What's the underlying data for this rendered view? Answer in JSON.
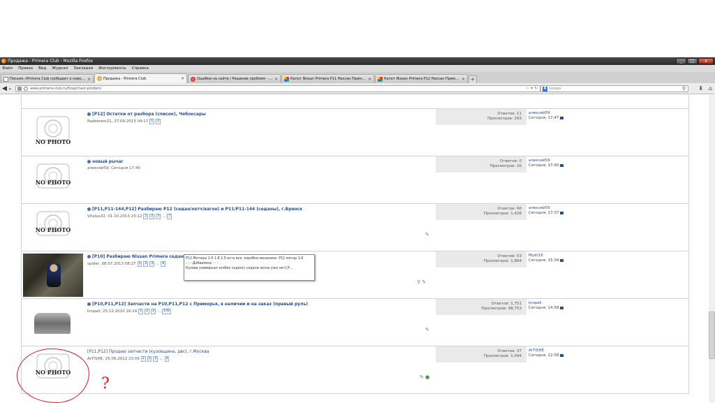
{
  "window": {
    "title": "Продажа - Primera Club - Mozilla Firefox",
    "buttons": [
      "_",
      "□",
      "x"
    ]
  },
  "menu": [
    "Файл",
    "Правка",
    "Вид",
    "Журнал",
    "Закладки",
    "Инструменты",
    "Справка"
  ],
  "tabs": [
    {
      "label": "Письмо «Primera Club сообщает о ново...",
      "icon": "page-icon"
    },
    {
      "label": "Продажа - Primera Club",
      "icon": "firefox-icon",
      "active": true
    },
    {
      "label": "Ошибки на сайте / Решение проблем - ...",
      "icon": "red-circle-icon"
    },
    {
      "label": "Капот Nissan Primera P11 Ниссан Прим...",
      "icon": "multicolor-icon"
    },
    {
      "label": "Капот Nissan Primera P12 Ниссан Прим...",
      "icon": "multicolor-icon"
    }
  ],
  "tab_close": "×",
  "new_tab": "+",
  "nav": {
    "url": "www.primera-club.ru/f/zapchast-prodam/",
    "search_placeholder": "Google",
    "search_engine_letter": "8"
  },
  "topics": [
    {
      "title": "[P12] Остатки от разбора (список), Чебоксары",
      "author_date": "Razberem21, 27.09.2013 04:17",
      "pages": [
        "1",
        "2"
      ],
      "replies": "Ответов: 11",
      "views": "Просмотров: 293",
      "last_author": "алексей59",
      "last_date": "Сегодня, 17:47",
      "thumb": "nophoto"
    },
    {
      "title": "новый рычаг",
      "author_date": "алексей59, Сегодня 17:40",
      "pages": [],
      "replies": "Ответов: 0",
      "views": "Просмотров: 26",
      "last_author": "алексей59",
      "last_date": "Сегодня, 17:40",
      "thumb": "nophoto"
    },
    {
      "title": "[P11,P11-144,P12] Разбираю P12 (седан/хетч/вагон) и P11/P11-144 (седаны), г.Брянск",
      "author_date": "Vitalya32, 01.10.2013 23:12",
      "pages": [
        "1",
        "2",
        "3",
        "...",
        "7"
      ],
      "replies": "Ответов: 66",
      "views": "Просмотров: 1,428",
      "last_author": "алексей59",
      "last_date": "Сегодня, 17:37",
      "thumb": "nophoto",
      "icons": "✎"
    },
    {
      "title": "[P10] Разбираю Nissan Primera седан",
      "author_date": "spider, 08.07.2013 08:27",
      "pages": [
        "1",
        "2",
        "3",
        "...",
        "6"
      ],
      "replies": "Ответов: 53",
      "views": "Просмотров: 1,864",
      "last_author": "Mydr16",
      "last_date": "Сегодня, 15:34",
      "thumb": "photo",
      "icons": "⚲ ✎"
    },
    {
      "title": "[P10,P11,P12] Запчасти на P10,P11,P12 с Приморья, в наличии и на заказ (правый руль)",
      "author_date": "kropali, 25.12.2010 18:24",
      "pages": [
        "1",
        "2",
        "3",
        "...",
        "176"
      ],
      "replies": "Ответов: 1,751",
      "views": "Просмотров: 98,753",
      "last_author": "kropali",
      "last_date": "Сегодня, 14:58",
      "thumb": "small",
      "icons": "✎"
    },
    {
      "title": "[P11,P12] Продаю запчасти (кузовщина, двс), г.Москва",
      "author_date": "ArTISHE, 25.09.2013 23:09",
      "pages": [
        "1",
        "2",
        "3",
        "...",
        "4"
      ],
      "replies": "Ответов: 37",
      "views": "Просмотров: 1,494",
      "last_author": "ArTISHE",
      "last_date": "Сегодня, 12:58",
      "thumb": "nophoto",
      "icons": "✎ ●"
    }
  ],
  "nophoto_text": "NO PHOTO",
  "tooltip": {
    "line1": "P12 Моторы 1.6 1.8 2.0 есть все. коробки механики .P11 мотор 1.6",
    "line2": "- - - Добавлено - - -",
    "line3": "Кузова универсал хэчбек седан(с седана жопы уже нет),Р..."
  },
  "annotation_mark": "?",
  "colors": {
    "link": "#2a4f8c",
    "annotation": "#d81818",
    "stats_bg": "#eaeaea"
  }
}
